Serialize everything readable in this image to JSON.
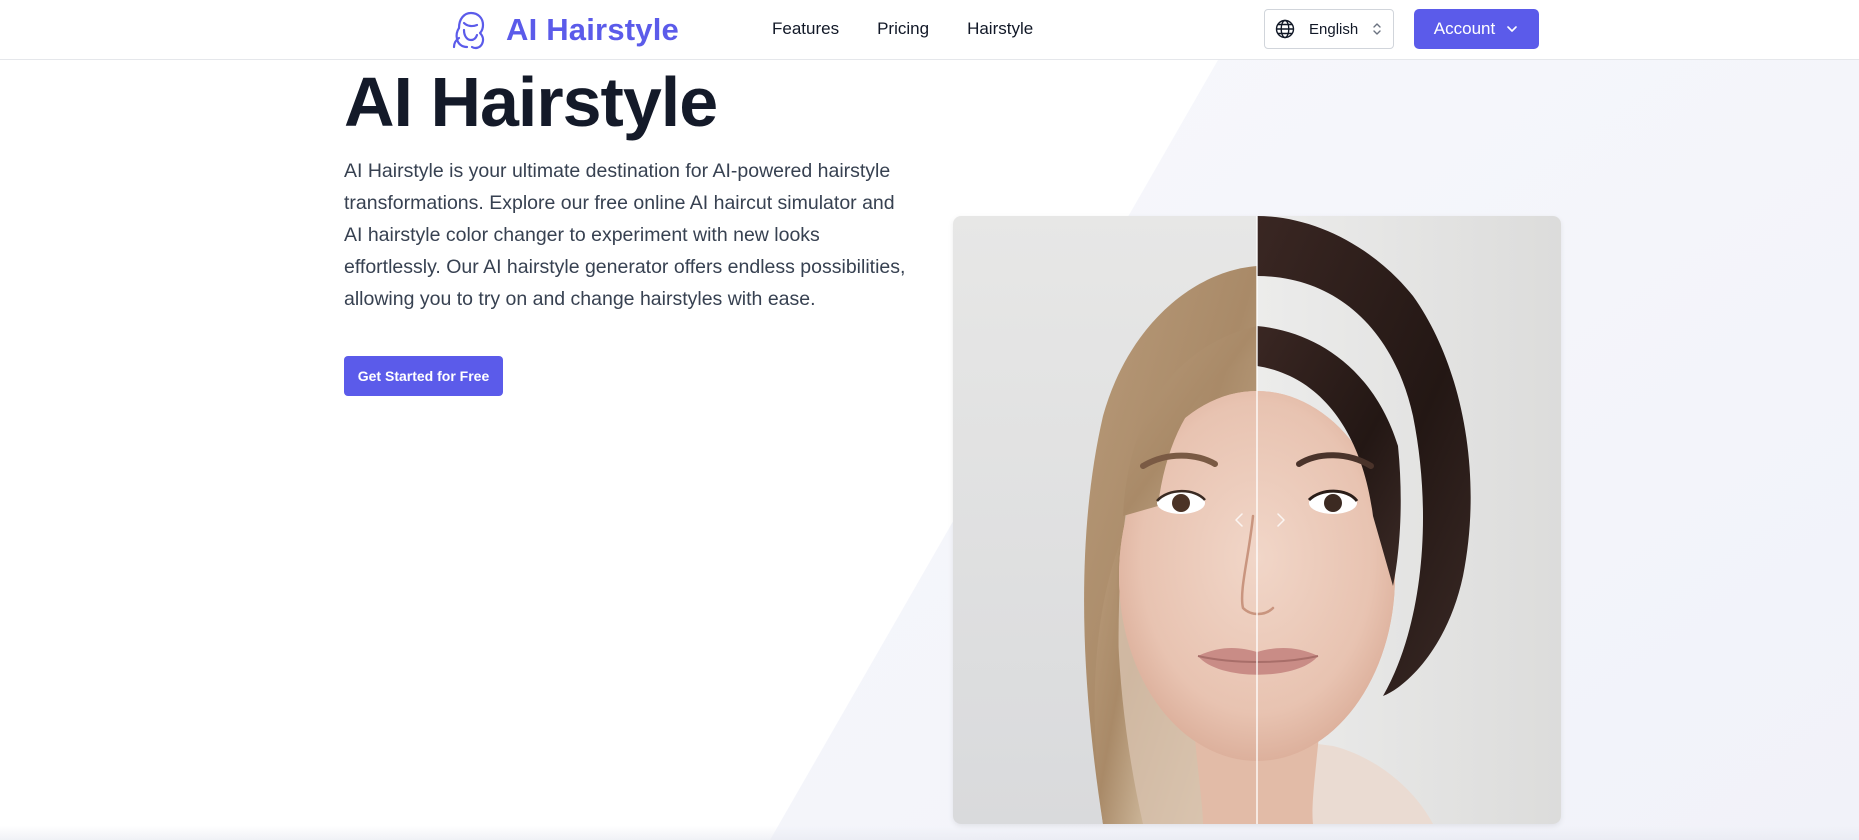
{
  "header": {
    "brand": "AI Hairstyle",
    "nav": [
      {
        "label": "Features"
      },
      {
        "label": "Pricing"
      },
      {
        "label": "Hairstyle"
      }
    ],
    "language": "English",
    "account_label": "Account"
  },
  "hero": {
    "title": "AI Hairstyle",
    "description": "AI Hairstyle is your ultimate destination for AI-powered hairstyle transformations. Explore our free online AI haircut simulator and AI hairstyle color changer to experiment with new looks effortlessly. Our AI hairstyle generator offers endless possibilities, allowing you to try on and change hairstyles with ease.",
    "cta_label": "Get Started for Free"
  },
  "compare": {
    "split": 0.5
  },
  "colors": {
    "accent": "#5b5bea",
    "title": "#141a29",
    "text": "#374151"
  },
  "icons": {
    "logo": "hair-woman-icon",
    "language": "globe-icon",
    "language_toggle": "up-down-chevron-icon",
    "account_toggle": "chevron-down-icon",
    "slider_left": "chevron-left-icon",
    "slider_right": "chevron-right-icon"
  }
}
